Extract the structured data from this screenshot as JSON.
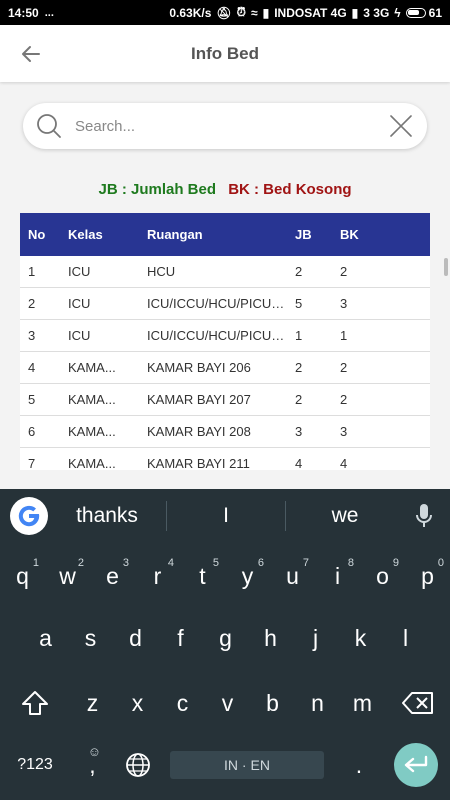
{
  "statusbar": {
    "time": "14:50",
    "network_speed": "0.63K/s",
    "carrier": "INDOSAT 4G",
    "network2": "3 3G",
    "battery": "61"
  },
  "appbar": {
    "title": "Info Bed"
  },
  "search": {
    "placeholder": "Search..."
  },
  "legend": {
    "jb": "JB : Jumlah Bed",
    "bk": "BK : Bed Kosong"
  },
  "table": {
    "headers": [
      "No",
      "Kelas",
      "Ruangan",
      "JB",
      "BK"
    ],
    "rows": [
      {
        "no": "1",
        "kelas": "ICU",
        "ruangan": "HCU",
        "jb": "2",
        "bk": "2"
      },
      {
        "no": "2",
        "kelas": "ICU",
        "ruangan": "ICU/ICCU/HCU/PICU/...",
        "jb": "5",
        "bk": "3"
      },
      {
        "no": "3",
        "kelas": "ICU",
        "ruangan": "ICU/ICCU/HCU/PICU/...",
        "jb": "1",
        "bk": "1"
      },
      {
        "no": "4",
        "kelas": "KAMA...",
        "ruangan": "KAMAR BAYI 206",
        "jb": "2",
        "bk": "2"
      },
      {
        "no": "5",
        "kelas": "KAMA...",
        "ruangan": "KAMAR BAYI 207",
        "jb": "2",
        "bk": "2"
      },
      {
        "no": "6",
        "kelas": "KAMA...",
        "ruangan": "KAMAR BAYI 208",
        "jb": "3",
        "bk": "3"
      },
      {
        "no": "7",
        "kelas": "KAMA...",
        "ruangan": "KAMAR BAYI 211",
        "jb": "4",
        "bk": "4"
      }
    ]
  },
  "keyboard": {
    "suggestions": [
      "thanks",
      "I",
      "we"
    ],
    "row1": [
      {
        "key": "q",
        "hint": "1"
      },
      {
        "key": "w",
        "hint": "2"
      },
      {
        "key": "e",
        "hint": "3"
      },
      {
        "key": "r",
        "hint": "4"
      },
      {
        "key": "t",
        "hint": "5"
      },
      {
        "key": "y",
        "hint": "6"
      },
      {
        "key": "u",
        "hint": "7"
      },
      {
        "key": "i",
        "hint": "8"
      },
      {
        "key": "o",
        "hint": "9"
      },
      {
        "key": "p",
        "hint": "0"
      }
    ],
    "row2": [
      "a",
      "s",
      "d",
      "f",
      "g",
      "h",
      "j",
      "k",
      "l"
    ],
    "row3": [
      "z",
      "x",
      "c",
      "v",
      "b",
      "n",
      "m"
    ],
    "symbols_label": "?123",
    "comma": ",",
    "language": "IN · EN",
    "period": "."
  },
  "colors": {
    "header_bg": "#283593",
    "jb_color": "#1e7a1e",
    "bk_color": "#a01414",
    "keyboard_bg": "#263238",
    "enter_key": "#80cbc4"
  },
  "icons": {
    "back": "arrow-left-icon",
    "search": "magnifier-icon",
    "clear": "close-icon",
    "mic": "mic-icon",
    "shift": "shift-icon",
    "backspace": "backspace-icon",
    "globe": "globe-icon",
    "enter": "enter-icon"
  }
}
